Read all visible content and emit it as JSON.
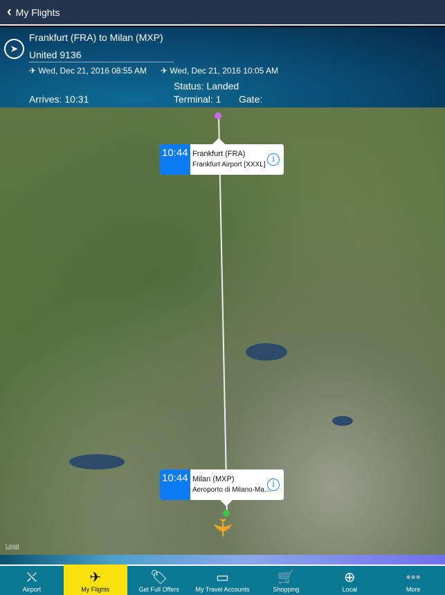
{
  "nav": {
    "back_label": "My Flights"
  },
  "flight": {
    "route": "Frankfurt (FRA) to Milan (MXP)",
    "flight_number": "United 9136",
    "departure": "Wed, Dec 21, 2016 08:55 AM",
    "arrival": "Wed, Dec 21, 2016 10:05 AM",
    "status": "Status: Landed",
    "arrives": "Arrives: 10:31",
    "terminal": "Terminal: 1",
    "gate": "Gate:"
  },
  "map": {
    "origin": {
      "time": "10:44",
      "title": "Frankfurt (FRA)",
      "subtitle": "Frankfurt Airport [XXXL]",
      "pin_color": "#c96be0"
    },
    "destination": {
      "time": "10:44",
      "title": "Milan (MXP)",
      "subtitle": "Aeroporto di Milano-Ma…",
      "pin_color": "#3ec24a"
    },
    "legal": "Legal",
    "plane_color": "#f5a623"
  },
  "tabs": [
    {
      "label": "Airport",
      "icon": "airport-icon"
    },
    {
      "label": "My Flights",
      "icon": "airplane-icon",
      "active": true
    },
    {
      "label": "Get Full Offers",
      "icon": "tag-icon"
    },
    {
      "label": "My Travel Accounts",
      "icon": "credit-card-icon"
    },
    {
      "label": "Shopping",
      "icon": "cart-icon"
    },
    {
      "label": "Local",
      "icon": "globe-icon"
    },
    {
      "label": "More",
      "icon": "more-icon"
    }
  ]
}
